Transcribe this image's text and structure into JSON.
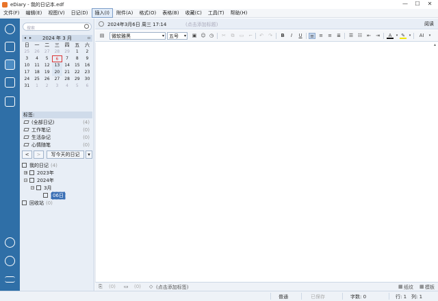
{
  "window": {
    "title": "eDiary - 我的日记本.edf",
    "min": "—",
    "max": "☐",
    "close": "✕"
  },
  "menu": [
    "文件(F)",
    "编辑(E)",
    "视图(V)",
    "日记(D)",
    "插入(I)",
    "附件(A)",
    "格式(O)",
    "表格(B)",
    "收藏(C)",
    "工具(T)",
    "帮助(H)"
  ],
  "menu_active_index": 4,
  "sidebar": {
    "search_placeholder": "搜索",
    "calendar": {
      "title": "2024 年 3 月",
      "weekdays": [
        "日",
        "一",
        "二",
        "三",
        "四",
        "五",
        "六"
      ],
      "weeks": [
        [
          "25",
          "26",
          "27",
          "28",
          "29",
          "1",
          "2"
        ],
        [
          "3",
          "4",
          "5",
          "6",
          "7",
          "8",
          "9"
        ],
        [
          "10",
          "11",
          "12",
          "13",
          "14",
          "15",
          "16"
        ],
        [
          "17",
          "18",
          "19",
          "20",
          "21",
          "22",
          "23"
        ],
        [
          "24",
          "25",
          "26",
          "27",
          "28",
          "29",
          "30"
        ],
        [
          "31",
          "1",
          "2",
          "3",
          "4",
          "5",
          "6"
        ]
      ],
      "today": "6"
    },
    "tags": {
      "header": "标签:",
      "items": [
        {
          "label": "(全部日记)",
          "count": "(4)"
        },
        {
          "label": "工作笔记",
          "count": "(0)"
        },
        {
          "label": "生活杂记",
          "count": "(0)"
        },
        {
          "label": "心情随笔",
          "count": "(0)"
        }
      ]
    },
    "nav": {
      "prev": "<",
      "next": ">",
      "today": "写今天的日记",
      "more": "▾"
    },
    "tree": {
      "root": "我的日记",
      "root_count": "(4)",
      "y2023": "2023年",
      "y2024": "2024年",
      "month": "3月",
      "day": "06日",
      "trash": "回收站",
      "trash_count": "(0)"
    }
  },
  "editor": {
    "date": "2024年3月6日 周三 17:14",
    "title_placeholder": "(点击添加标题)",
    "read_mode": "阅读",
    "font": "微软雅黑",
    "size": "五号"
  },
  "bottombar": {
    "attach_count": "(0)",
    "comment_count": "(0)",
    "tag_placeholder": "(点击添加标签)",
    "paper": "纸纹",
    "template": "模板"
  },
  "status": {
    "mode": "普通",
    "saved": "已保存",
    "chars": "字数: 0",
    "row": "行: 1",
    "col": "列: 1"
  }
}
